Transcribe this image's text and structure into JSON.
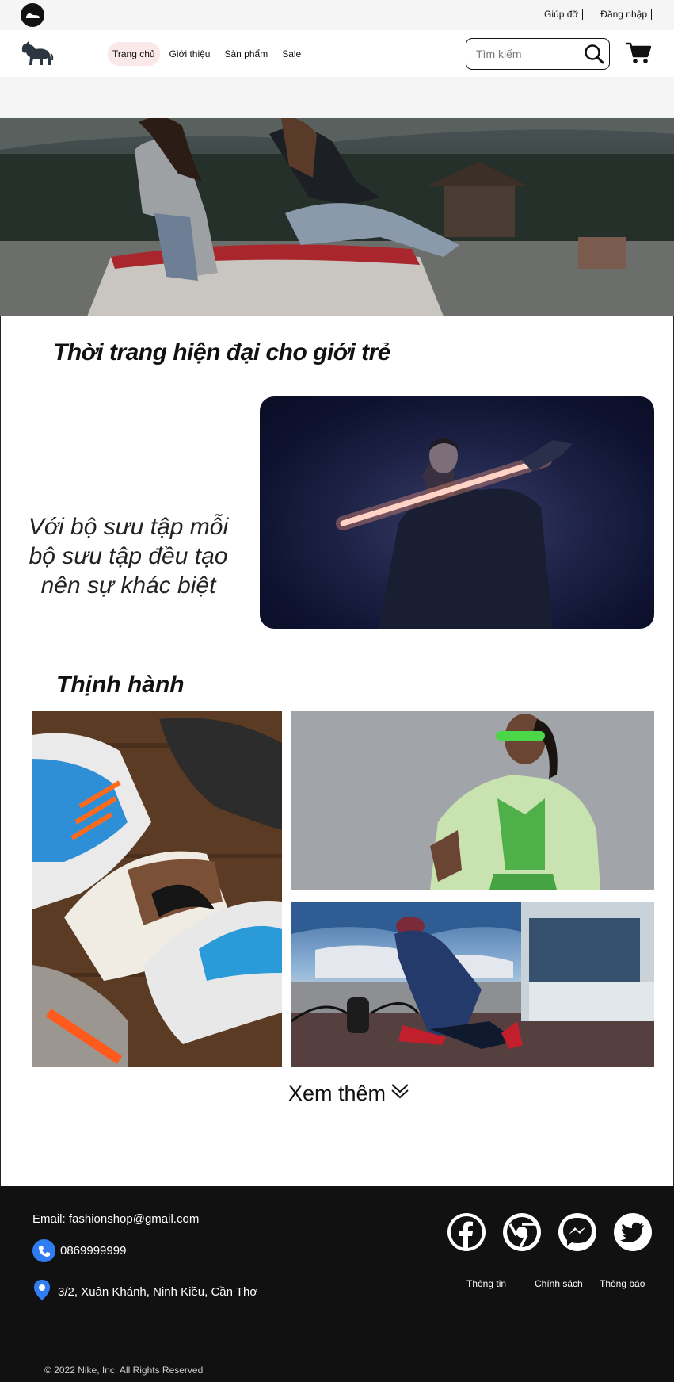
{
  "topbar": {
    "logo_icon": "shoe-icon",
    "links": [
      "Giúp đỡ",
      "Đăng nhập"
    ]
  },
  "nav": {
    "brand_icon": "panther-logo-icon",
    "menu": [
      {
        "label": "Trang chủ",
        "active": true
      },
      {
        "label": "Giới thiệu",
        "active": false
      },
      {
        "label": "Sản phẩm",
        "active": false
      },
      {
        "label": "Sale",
        "active": false
      }
    ],
    "search": {
      "placeholder": "Tìm kiếm"
    },
    "cart_icon": "cart-icon"
  },
  "hero": {
    "image": "two-women-sitting-on-car-photo"
  },
  "intro": {
    "heading": "Thời trang hiện đại cho giới trẻ",
    "tagline": "Với bộ sưu tập mỗi bộ sưu tập đều tạo nên sự khác biệt",
    "feature_image": "woman-holding-neon-light-photo"
  },
  "trending": {
    "heading": "Thịnh hành",
    "images": [
      "sneakers-collection-photo",
      "woman-green-outfit-photo",
      "man-street-style-photo"
    ],
    "more_label": "Xem thêm"
  },
  "footer": {
    "email": "Email: fashionshop@gmail.com",
    "phone": "0869999999",
    "address": "3/2, Xuân Khánh, Ninh Kiều, Cần Thơ",
    "social_icons": [
      "facebook-icon",
      "chrome-icon",
      "messenger-icon",
      "twitter-icon"
    ],
    "links": [
      "Thông tin",
      "Chính sách",
      "Thông báo"
    ],
    "copyright": "© 2022 Nike, Inc. All Rights Reserved"
  },
  "colors": {
    "accent_blue": "#2f7df0",
    "footer_bg": "#111111",
    "active_tab_bg": "#fbe9e9"
  }
}
